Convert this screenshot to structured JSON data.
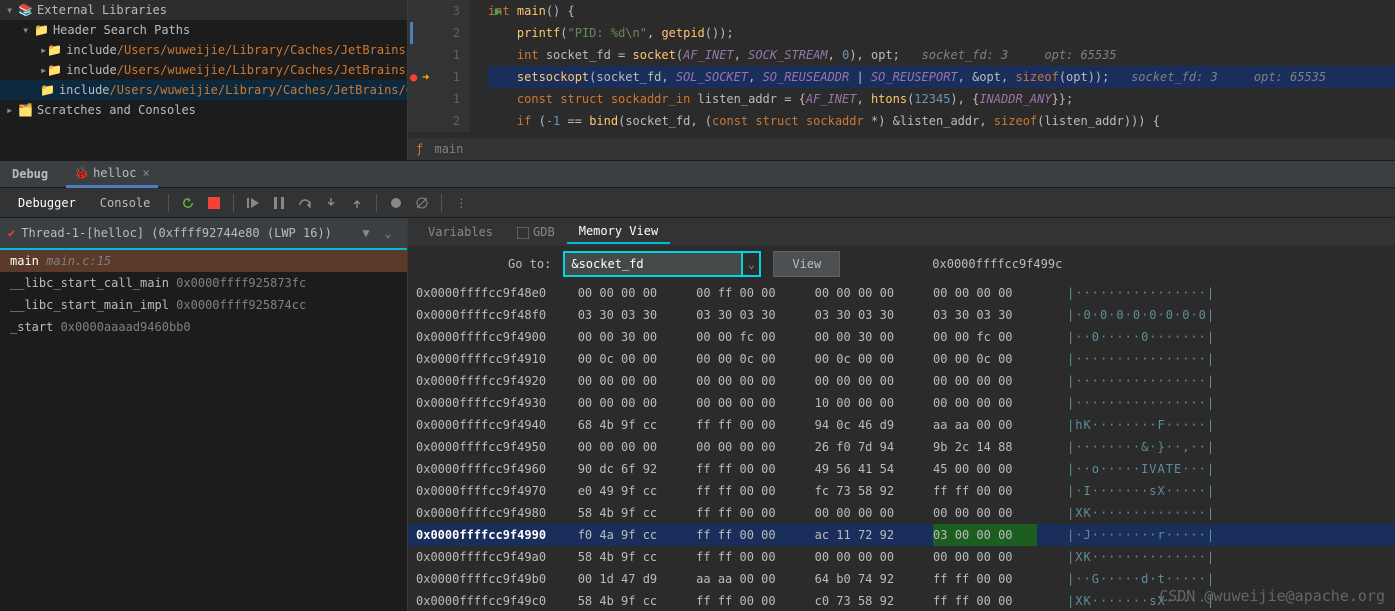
{
  "tree": {
    "root1": "External Libraries",
    "sub1": "Header Search Paths",
    "inc_label": "include",
    "inc_path": "/Users/wuweijie/Library/Caches/JetBrains/CL",
    "root2": "Scratches and Consoles"
  },
  "editor": {
    "lines": [
      3,
      2,
      1,
      1,
      1,
      2
    ],
    "l1": {
      "a": "int ",
      "b": "main",
      "c": "() {"
    },
    "l2": {
      "a": "    ",
      "b": "printf",
      "c": "(",
      "d": "\"PID: %d\\n\"",
      "e": ", ",
      "f": "getpid",
      "g": "());"
    },
    "l3": {
      "a": "    ",
      "b": "int ",
      "c": "socket_fd = ",
      "d": "socket",
      "e": "(",
      "f": "AF_INET",
      "g": ", ",
      "h": "SOCK_STREAM",
      "i": ", ",
      "j": "0",
      "k": "), opt;",
      "inl": "   socket_fd: 3     opt: 65535"
    },
    "l4": {
      "a": "    ",
      "b": "setsockopt",
      "c": "(socket_fd, ",
      "d": "SOL_SOCKET",
      "e": ", ",
      "f": "SO_REUSEADDR",
      "g": " | ",
      "h": "SO_REUSEPORT",
      "i": ", &opt, ",
      "j": "sizeof",
      "k": "(opt));",
      "inl": "   socket_fd: 3     opt: 65535"
    },
    "l5": {
      "a": "    ",
      "b": "const struct ",
      "c": "sockaddr_in ",
      "d": "listen_addr = {",
      "e": "AF_INET",
      "f": ", ",
      "g": "htons",
      "h": "(",
      "i": "12345",
      "j": "), {",
      "k": "INADDR_ANY",
      "l": "}};"
    },
    "l6": {
      "a": "    ",
      "b": "if ",
      "c": "(",
      "d": "-1",
      "e": " == ",
      "f": "bind",
      "g": "(socket_fd, (",
      "h": "const struct ",
      "i": "sockaddr ",
      "j": "*) &listen_addr, ",
      "k": "sizeof",
      "l": "(listen_addr))) {"
    },
    "breadcrumb": "main"
  },
  "debug": {
    "title": "Debug",
    "tab": "helloc",
    "tab_debugger": "Debugger",
    "tab_console": "Console"
  },
  "frames": {
    "thread": "Thread-1-[helloc] (0xffff92744e80 (LWP 16))",
    "items": [
      {
        "main": "main",
        "sec": " main.c:15",
        "sel": true
      },
      {
        "main": "__libc_start_call_main",
        "sec": " 0x0000ffff925873fc"
      },
      {
        "main": "__libc_start_main_impl",
        "sec": " 0x0000ffff925874cc"
      },
      {
        "main": "_start",
        "sec": " 0x0000aaaad9460bb0"
      }
    ]
  },
  "right": {
    "tab_vars": "Variables",
    "tab_gdb": "GDB",
    "tab_mem": "Memory View",
    "goto_label": "Go to:",
    "goto_value": "&socket_fd",
    "view_btn": "View",
    "cur_addr": "0x0000ffffcc9f499c"
  },
  "mem": [
    {
      "a": "0x0000ffffcc9f48e0",
      "h": [
        "00 00 00 00",
        "00 ff 00 00",
        "00 00 00 00",
        "00 00 00 00"
      ],
      "t": "················"
    },
    {
      "a": "0x0000ffffcc9f48f0",
      "h": [
        "03 30 03 30",
        "03 30 03 30",
        "03 30 03 30",
        "03 30 03 30"
      ],
      "t": "·0·0·0·0·0·0·0·0"
    },
    {
      "a": "0x0000ffffcc9f4900",
      "h": [
        "00 00 30 00",
        "00 00 fc 00",
        "00 00 30 00",
        "00 00 fc 00"
      ],
      "t": "··0·····0·······"
    },
    {
      "a": "0x0000ffffcc9f4910",
      "h": [
        "00 0c 00 00",
        "00 00 0c 00",
        "00 0c 00 00",
        "00 00 0c 00"
      ],
      "t": "················"
    },
    {
      "a": "0x0000ffffcc9f4920",
      "h": [
        "00 00 00 00",
        "00 00 00 00",
        "00 00 00 00",
        "00 00 00 00"
      ],
      "t": "················"
    },
    {
      "a": "0x0000ffffcc9f4930",
      "h": [
        "00 00 00 00",
        "00 00 00 00",
        "10 00 00 00",
        "00 00 00 00"
      ],
      "t": "················"
    },
    {
      "a": "0x0000ffffcc9f4940",
      "h": [
        "68 4b 9f cc",
        "ff ff 00 00",
        "94 0c 46 d9",
        "aa aa 00 00"
      ],
      "t": "hK········F·····"
    },
    {
      "a": "0x0000ffffcc9f4950",
      "h": [
        "00 00 00 00",
        "00 00 00 00",
        "26 f0 7d 94",
        "9b 2c 14 88"
      ],
      "t": "········&·}··,··"
    },
    {
      "a": "0x0000ffffcc9f4960",
      "h": [
        "90 dc 6f 92",
        "ff ff 00 00",
        "49 56 41 54",
        "45 00 00 00"
      ],
      "t": "··o·····IVATE···"
    },
    {
      "a": "0x0000ffffcc9f4970",
      "h": [
        "e0 49 9f cc",
        "ff ff 00 00",
        "fc 73 58 92",
        "ff ff 00 00"
      ],
      "t": "·I·······sX·····"
    },
    {
      "a": "0x0000ffffcc9f4980",
      "h": [
        "58 4b 9f cc",
        "ff ff 00 00",
        "00 00 00 00",
        "00 00 00 00"
      ],
      "t": "XK··············",
      "b4": true
    },
    {
      "a": "0x0000ffffcc9f4990",
      "h": [
        "f0 4a 9f cc",
        "ff ff 00 00",
        "ac 11 72 92",
        "03 00 00 00"
      ],
      "t": "·J········r·····",
      "hl": true,
      "green": 3
    },
    {
      "a": "0x0000ffffcc9f49a0",
      "h": [
        "58 4b 9f cc",
        "ff ff 00 00",
        "00 00 00 00",
        "00 00 00 00"
      ],
      "t": "XK··············"
    },
    {
      "a": "0x0000ffffcc9f49b0",
      "h": [
        "00 1d 47 d9",
        "aa aa 00 00",
        "64 b0 74 92",
        "ff ff 00 00"
      ],
      "t": "··G·····d·t·····"
    },
    {
      "a": "0x0000ffffcc9f49c0",
      "h": [
        "58 4b 9f cc",
        "ff ff 00 00",
        "c0 73 58 92",
        "ff ff 00 00"
      ],
      "t": "XK·······sX·····"
    }
  ],
  "watermark": "CSDN @wuweijie@apache.org"
}
